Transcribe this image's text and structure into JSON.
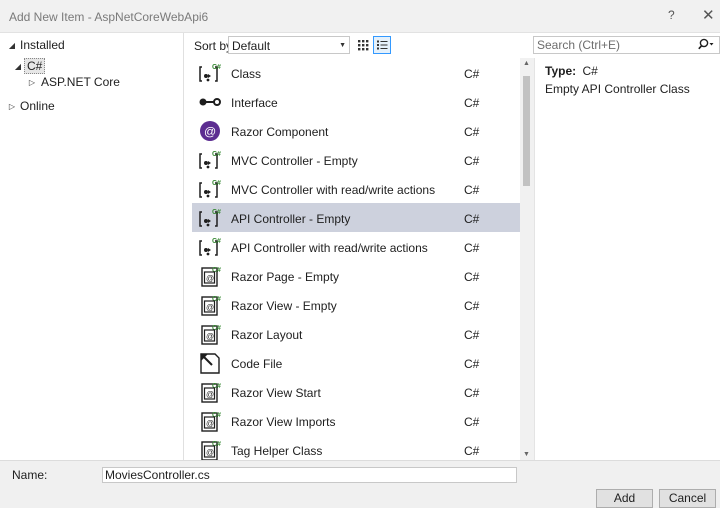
{
  "window": {
    "title": "Add New Item - AspNetCoreWebApi6",
    "help_label": "?",
    "close_label": "✕"
  },
  "tree": {
    "installed": "Installed",
    "csharp": "C#",
    "aspnet_core": "ASP.NET Core",
    "online": "Online"
  },
  "toolbar": {
    "sort_label": "Sort by:",
    "sort_value": "Default"
  },
  "search": {
    "placeholder": "Search (Ctrl+E)"
  },
  "templates": [
    {
      "label": "Class",
      "lang": "C#",
      "icon": "csharp-class-icon"
    },
    {
      "label": "Interface",
      "lang": "C#",
      "icon": "interface-icon"
    },
    {
      "label": "Razor Component",
      "lang": "C#",
      "icon": "razor-component-icon"
    },
    {
      "label": "MVC Controller - Empty",
      "lang": "C#",
      "icon": "controller-icon"
    },
    {
      "label": "MVC Controller with read/write actions",
      "lang": "C#",
      "icon": "controller-icon"
    },
    {
      "label": "API Controller - Empty",
      "lang": "C#",
      "icon": "controller-icon",
      "selected": true
    },
    {
      "label": "API Controller with read/write actions",
      "lang": "C#",
      "icon": "controller-icon"
    },
    {
      "label": "Razor Page - Empty",
      "lang": "C#",
      "icon": "razor-page-icon"
    },
    {
      "label": "Razor View - Empty",
      "lang": "C#",
      "icon": "razor-view-icon"
    },
    {
      "label": "Razor Layout",
      "lang": "C#",
      "icon": "razor-layout-icon"
    },
    {
      "label": "Code File",
      "lang": "C#",
      "icon": "code-file-icon"
    },
    {
      "label": "Razor View Start",
      "lang": "C#",
      "icon": "razor-view-start-icon"
    },
    {
      "label": "Razor View Imports",
      "lang": "C#",
      "icon": "razor-view-imports-icon"
    },
    {
      "label": "Tag Helper Class",
      "lang": "C#",
      "icon": "tag-helper-icon"
    }
  ],
  "details": {
    "type_label": "Type:",
    "type_value": "C#",
    "description": "Empty API Controller Class"
  },
  "name_field": {
    "label": "Name:",
    "value": "MoviesController.cs"
  },
  "buttons": {
    "add": "Add",
    "cancel": "Cancel"
  },
  "colors": {
    "selection": "#cdd1dd",
    "csharp_green": "#388a34",
    "razor_purple": "#5c2d91"
  }
}
